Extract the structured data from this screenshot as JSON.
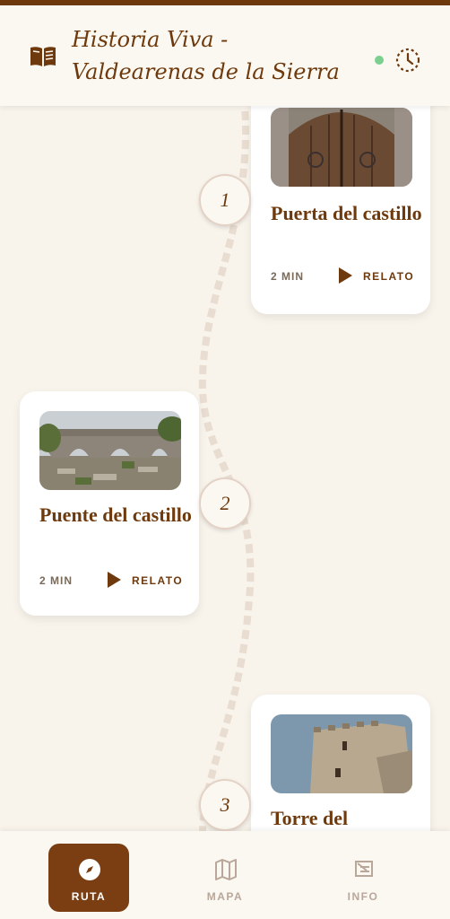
{
  "header": {
    "title": "Historia Viva - Valdearenas de la Sierra",
    "icons": {
      "left": "open-book-icon",
      "right": "history-clock-icon"
    },
    "status_color": "#7bd08f"
  },
  "route": {
    "stops": [
      {
        "number": "1",
        "name": "Puerta del castillo",
        "duration": "2 MIN",
        "action": "RELATO",
        "image": "castle-gate-photo"
      },
      {
        "number": "2",
        "name": "Puente del castillo",
        "duration": "2 MIN",
        "action": "RELATO",
        "image": "stone-bridge-photo"
      },
      {
        "number": "3",
        "name": "Torre del",
        "image": "tower-photo"
      }
    ]
  },
  "navbar": {
    "items": [
      {
        "label": "RUTA",
        "icon": "compass-icon",
        "active": true
      },
      {
        "label": "MAPA",
        "icon": "map-icon",
        "active": false
      },
      {
        "label": "INFO",
        "icon": "sign-icon",
        "active": false
      }
    ]
  },
  "colors": {
    "brand": "#6e3a0d",
    "background": "#f8f4ec",
    "active_nav": "#7a3e12"
  }
}
